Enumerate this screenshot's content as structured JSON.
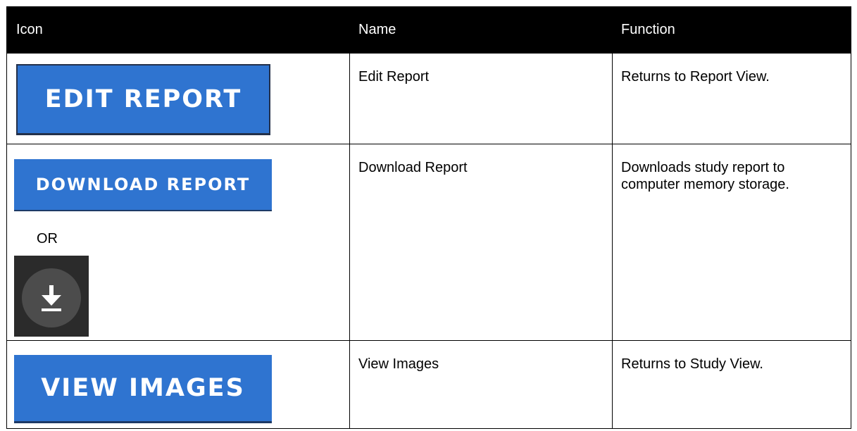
{
  "table": {
    "headers": [
      "Icon",
      "Name",
      "Function"
    ],
    "rows": [
      {
        "button_label": "EDIT REPORT",
        "name": "Edit Report",
        "function": "Returns to Report View."
      },
      {
        "button_label": "DOWNLOAD REPORT",
        "or_text": "OR",
        "alt_icon": "download-icon",
        "name": "Download Report",
        "function_line1": "Downloads study report to",
        "function_line2": "computer memory storage."
      },
      {
        "button_label": "VIEW IMAGES",
        "name": "View Images",
        "function": "Returns to Study View."
      }
    ]
  },
  "colors": {
    "header_bg": "#000000",
    "button_blue": "#2f74d0",
    "icon_tile_bg": "#2b2b2b",
    "icon_circle_bg": "#4c4c4c"
  }
}
